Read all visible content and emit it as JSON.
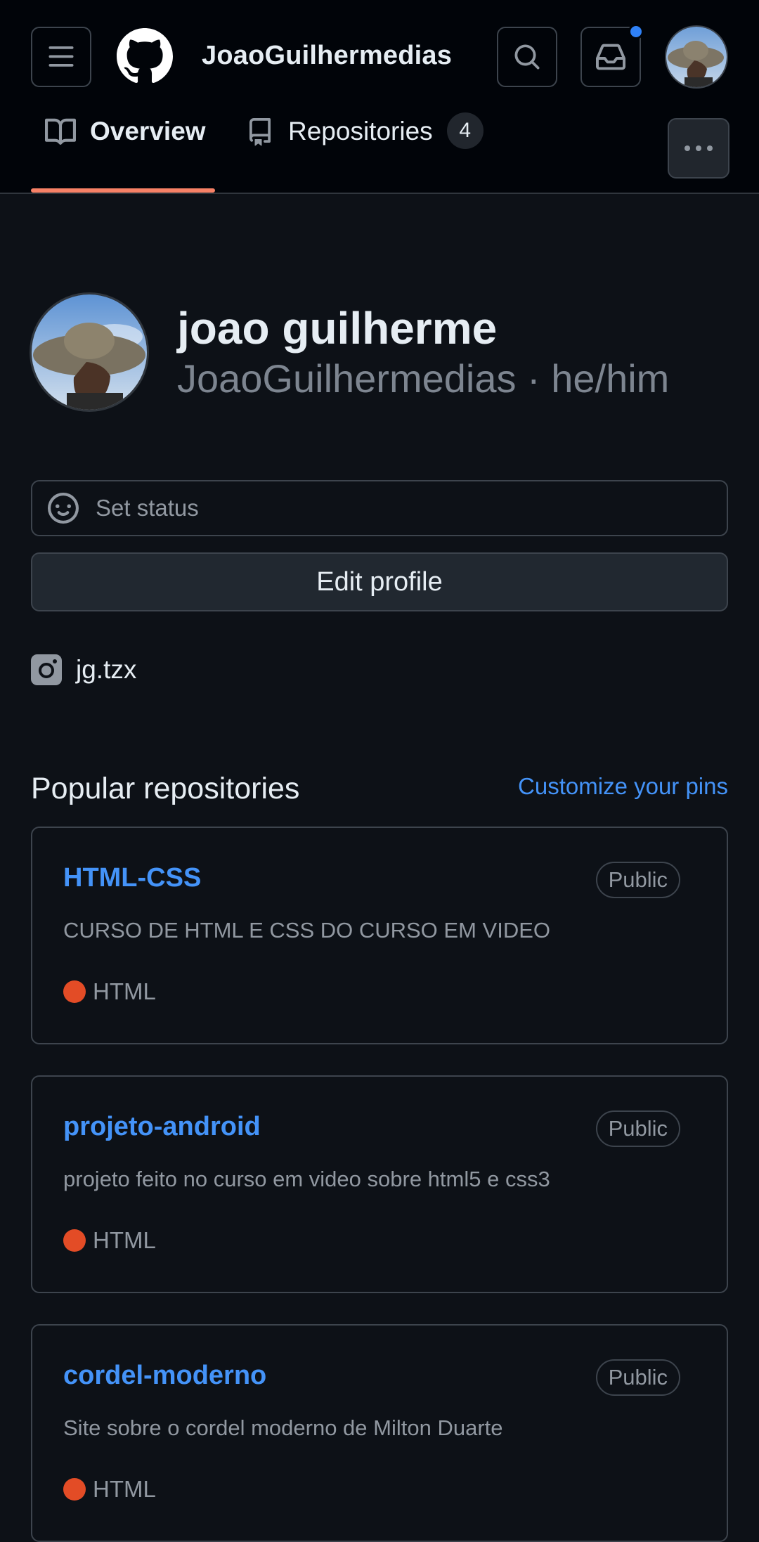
{
  "header": {
    "username": "JoaoGuilhermedias",
    "icons": [
      "menu-icon",
      "github-logo",
      "search-icon",
      "inbox-icon",
      "avatar"
    ]
  },
  "tabs": [
    {
      "label": "Overview",
      "icon": "book-icon",
      "selected": true
    },
    {
      "label": "Repositories",
      "icon": "repo-icon",
      "count": "4"
    }
  ],
  "profile": {
    "full_name": "joao guilherme",
    "login_line": "JoaoGuilhermedias · he/him",
    "status_placeholder": "Set status",
    "edit_label": "Edit profile",
    "social": "jg.tzx"
  },
  "popular": {
    "title": "Popular repositories",
    "customize": "Customize your pins",
    "repos": [
      {
        "name": "HTML-CSS",
        "visibility": "Public",
        "description": "CURSO DE HTML E CSS DO CURSO EM VIDEO",
        "language": "HTML"
      },
      {
        "name": "projeto-android",
        "visibility": "Public",
        "description": "projeto feito no curso em video sobre html5 e css3",
        "language": "HTML"
      },
      {
        "name": "cordel-moderno",
        "visibility": "Public",
        "description": "Site sobre o cordel moderno de Milton Duarte",
        "language": "HTML"
      }
    ]
  },
  "colors": {
    "accent_blue": "#4493f8",
    "underline": "#f78166",
    "html_lang": "#e34c26",
    "notification": "#2f81f7"
  }
}
